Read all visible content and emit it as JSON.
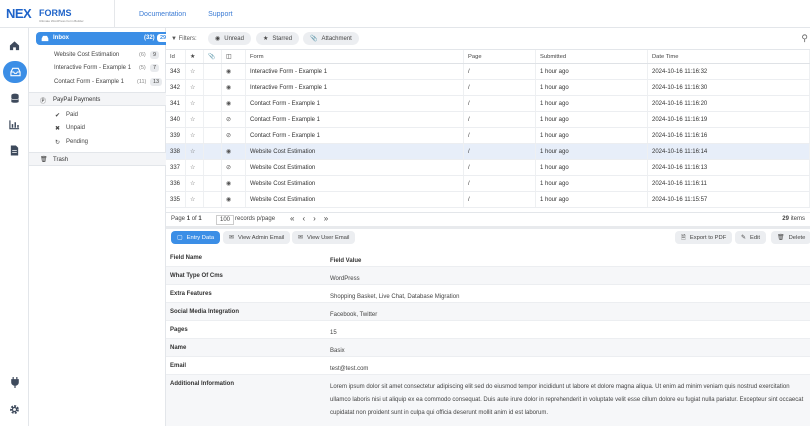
{
  "brand": {
    "logo_text": "NEXFORMS",
    "tagline": "Ultimate WordPress Form Builder"
  },
  "topnav": {
    "documentation": "Documentation",
    "support": "Support"
  },
  "rail": [
    "home-icon",
    "inbox-icon",
    "database-icon",
    "chart-icon",
    "file-icon",
    "plug-icon",
    "gear-icon"
  ],
  "sidebar": {
    "inbox": {
      "label": "Inbox",
      "count": "(32)",
      "badge": "29"
    },
    "forms": [
      {
        "label": "Website Cost Estimation",
        "count": "(6)",
        "badge": "9"
      },
      {
        "label": "Interactive Form - Example 1",
        "count": "(5)",
        "badge": "7"
      },
      {
        "label": "Contact Form - Example 1",
        "count": "(11)",
        "badge": "13"
      }
    ],
    "paypal": {
      "label": "PayPal Payments",
      "items": [
        {
          "icon": "check-icon",
          "label": "Paid"
        },
        {
          "icon": "x-icon",
          "label": "Unpaid"
        },
        {
          "icon": "refresh-icon",
          "label": "Pending"
        }
      ]
    },
    "trash": "Trash"
  },
  "filters": {
    "label": "Filters:",
    "chips": [
      {
        "icon": "eye-slash-icon",
        "label": "Unread"
      },
      {
        "icon": "star-icon",
        "label": "Starred"
      },
      {
        "icon": "paperclip-icon",
        "label": "Attachment"
      }
    ]
  },
  "table": {
    "headers": [
      "Id",
      "",
      "",
      "",
      "Form",
      "Page",
      "Submitted",
      "Date Time"
    ],
    "rows": [
      {
        "id": "343",
        "form": "Interactive Form - Example 1",
        "page": "/",
        "submitted": "1 hour ago",
        "datetime": "2024-10-16 11:16:32",
        "read": true
      },
      {
        "id": "342",
        "form": "Interactive Form - Example 1",
        "page": "/",
        "submitted": "1 hour ago",
        "datetime": "2024-10-16 11:16:30",
        "read": true
      },
      {
        "id": "341",
        "form": "Contact Form - Example 1",
        "page": "/",
        "submitted": "1 hour ago",
        "datetime": "2024-10-16 11:16:20",
        "read": true
      },
      {
        "id": "340",
        "form": "Contact Form - Example 1",
        "page": "/",
        "submitted": "1 hour ago",
        "datetime": "2024-10-16 11:16:19",
        "read": false
      },
      {
        "id": "339",
        "form": "Contact Form - Example 1",
        "page": "/",
        "submitted": "1 hour ago",
        "datetime": "2024-10-16 11:16:16",
        "read": false
      },
      {
        "id": "338",
        "form": "Website Cost Estimation",
        "page": "/",
        "submitted": "1 hour ago",
        "datetime": "2024-10-16 11:16:14",
        "read": true,
        "selected": true
      },
      {
        "id": "337",
        "form": "Website Cost Estimation",
        "page": "/",
        "submitted": "1 hour ago",
        "datetime": "2024-10-16 11:16:13",
        "read": false
      },
      {
        "id": "336",
        "form": "Website Cost Estimation",
        "page": "/",
        "submitted": "1 hour ago",
        "datetime": "2024-10-16 11:16:11",
        "read": true
      },
      {
        "id": "335",
        "form": "Website Cost Estimation",
        "page": "/",
        "submitted": "1 hour ago",
        "datetime": "2024-10-16 11:15:57",
        "read": true
      }
    ]
  },
  "pager": {
    "page_label": "Page",
    "page": "1",
    "of_label": "of",
    "total": "1",
    "per_page": "100",
    "per_page_label": "records p/page",
    "items": "29",
    "items_label": "items"
  },
  "actions": {
    "entry_data": "Entry Data",
    "view_admin": "View Admin Email",
    "view_user": "View User Email",
    "export": "Export to PDF",
    "edit": "Edit",
    "delete": "Delete"
  },
  "detail": {
    "header_field": "Field Name",
    "header_value": "Field Value",
    "rows": [
      {
        "field": "What Type Of Cms",
        "value": "WordPress"
      },
      {
        "field": "Extra Features",
        "value": "Shopping Basket, Live Chat, Database Migration"
      },
      {
        "field": "Social Media Integration",
        "value": "Facebook, Twitter"
      },
      {
        "field": "Pages",
        "value": "15"
      },
      {
        "field": "Name",
        "value": "Basix"
      },
      {
        "field": "Email",
        "value": "test@test.com"
      },
      {
        "field": "Additional Information",
        "value": "Lorem ipsum dolor sit amet consectetur adipiscing elit sed do eiusmod tempor incididunt ut labore et dolore magna aliqua. Ut enim ad minim veniam quis nostrud exercitation ullamco laboris nisi ut aliquip ex ea commodo consequat. Duis aute irure dolor in reprehenderit in voluptate velit esse cillum dolore eu fugiat nulla pariatur. Excepteur sint occaecat cupidatat non proident sunt in culpa qui officia deserunt mollit anim id est laborum."
      }
    ]
  },
  "colors": {
    "accent": "#3b8ee6",
    "selected_row": "#e7eef9",
    "brand_blue": "#1e63c9"
  }
}
